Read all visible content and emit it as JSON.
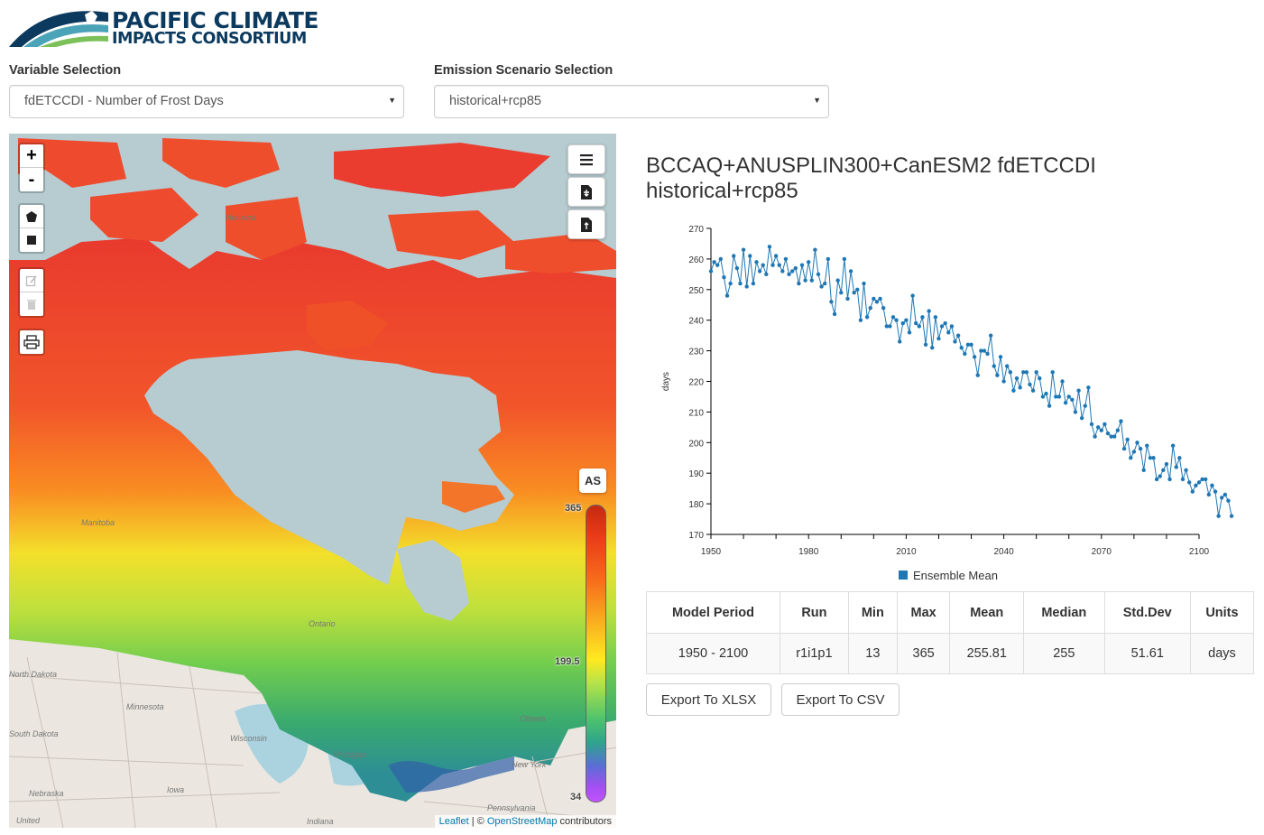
{
  "logo": {
    "line1": "PACIFIC CLIMATE",
    "line2": "IMPACTS CONSORTIUM"
  },
  "variable": {
    "label": "Variable Selection",
    "selected": "fdETCCDI - Number of Frost Days"
  },
  "scenario": {
    "label": "Emission Scenario Selection",
    "selected": "historical+rcp85"
  },
  "map": {
    "zoom_in": "+",
    "zoom_out": "-",
    "as_label": "AS",
    "legend": {
      "max": "365",
      "mid": "199.5",
      "min": "34"
    },
    "place_labels": [
      "Nunavut",
      "Manitoba",
      "Ontario",
      "North Dakota",
      "Minnesota",
      "South Dakota",
      "Wisconsin",
      "Michigan",
      "Ottawa",
      "New York",
      "Nebraska",
      "Iowa",
      "United",
      "Indiana",
      "Pennsylvania"
    ],
    "attribution": {
      "leaflet": "Leaflet",
      "sep": " | © ",
      "osm": "OpenStreetMap",
      "suffix": " contributors"
    }
  },
  "chart_title": "BCCAQ+ANUSPLIN300+CanESM2 fdETCCDI historical+rcp85",
  "chart_data": {
    "type": "line",
    "ylabel": "days",
    "xlabel": "",
    "xlim": [
      1950,
      2100
    ],
    "ylim": [
      170,
      270
    ],
    "x_ticks": [
      "1950",
      "1980",
      "2010",
      "2040",
      "2070",
      "2100"
    ],
    "y_ticks": [
      "170",
      "180",
      "190",
      "200",
      "210",
      "220",
      "230",
      "240",
      "250",
      "260",
      "270"
    ],
    "legend": "Ensemble Mean",
    "series": [
      {
        "name": "Ensemble Mean",
        "color": "#1f77b4",
        "x_start": 1950,
        "values": [
          256,
          259,
          258,
          260,
          254,
          248,
          252,
          261,
          257,
          252,
          263,
          251,
          261,
          252,
          259,
          256,
          258,
          255,
          264,
          258,
          261,
          258,
          256,
          260,
          255,
          256,
          257,
          252,
          258,
          253,
          259,
          253,
          263,
          255,
          251,
          252,
          260,
          246,
          242,
          253,
          249,
          260,
          247,
          256,
          249,
          250,
          240,
          252,
          241,
          244,
          247,
          246,
          247,
          244,
          238,
          238,
          241,
          240,
          233,
          239,
          240,
          236,
          248,
          239,
          238,
          241,
          232,
          243,
          231,
          241,
          234,
          238,
          239,
          236,
          238,
          233,
          235,
          231,
          229,
          232,
          232,
          228,
          222,
          230,
          230,
          229,
          235,
          225,
          222,
          228,
          220,
          225,
          223,
          217,
          221,
          218,
          223,
          223,
          219,
          217,
          223,
          221,
          215,
          216,
          212,
          223,
          215,
          215,
          220,
          213,
          215,
          214,
          210,
          217,
          208,
          212,
          218,
          206,
          202,
          205,
          204,
          206,
          203,
          202,
          202,
          204,
          207,
          198,
          201,
          195,
          197,
          200,
          198,
          191,
          199,
          195,
          195,
          188,
          189,
          191,
          193,
          188,
          199,
          192,
          195,
          188,
          191,
          187,
          184,
          186,
          187,
          188,
          188,
          183,
          186,
          184,
          176,
          182,
          183,
          181,
          176
        ]
      }
    ]
  },
  "table": {
    "headers": [
      "Model Period",
      "Run",
      "Min",
      "Max",
      "Mean",
      "Median",
      "Std.Dev",
      "Units"
    ],
    "row": [
      "1950 - 2100",
      "r1i1p1",
      "13",
      "365",
      "255.81",
      "255",
      "51.61",
      "days"
    ]
  },
  "buttons": {
    "xlsx": "Export To XLSX",
    "csv": "Export To CSV"
  }
}
